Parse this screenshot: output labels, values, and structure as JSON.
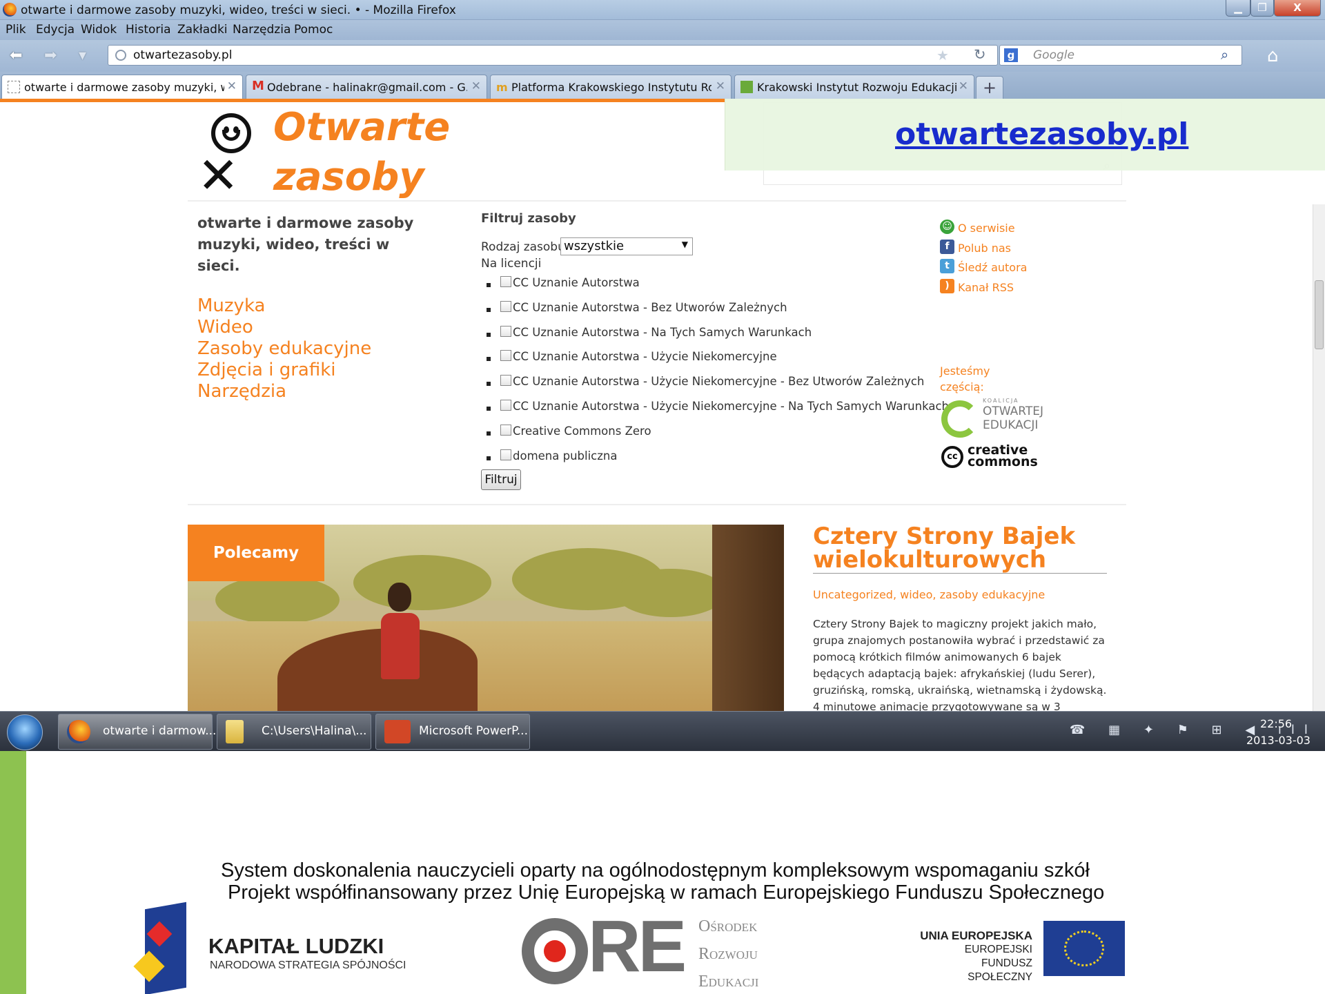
{
  "window": {
    "title": "otwarte i darmowe zasoby muzyki, wideo, treści w sieci. • - Mozilla Firefox",
    "controls": {
      "minimize": "▁",
      "maximize": "❐",
      "close": "X"
    }
  },
  "menubar": {
    "items": [
      "Plik",
      "Edycja",
      "Widok",
      "Historia",
      "Zakładki",
      "Narzędzia",
      "Pomoc"
    ]
  },
  "navbar": {
    "url": "otwartezasoby.pl",
    "search_placeholder": "Google"
  },
  "tabs": [
    {
      "label": "otwarte i darmowe zasoby muzyki, wi..."
    },
    {
      "label": "Odebrane - halinakr@gmail.com - G..."
    },
    {
      "label": "Platforma Krakowskiego Instytutu Ro..."
    },
    {
      "label": "Krakowski Instytut Rozwoju Edukacji ..."
    }
  ],
  "site": {
    "logo_line1": "Otwarte",
    "logo_line2": "zasoby",
    "overlay_link": "otwartezasoby.pl",
    "tagline": "otwarte i darmowe zasoby muzyki, wideo, treści w sieci.",
    "categories": [
      "Muzyka",
      "Wideo",
      "Zasoby edukacyjne",
      "Zdjęcia i grafiki",
      "Narzędzia"
    ],
    "filter": {
      "title": "Filtruj zasoby",
      "type_label": "Rodzaj zasobu",
      "type_value": "wszystkie",
      "license_label": "Na licencji",
      "licenses": [
        "CC Uznanie Autorstwa",
        "CC Uznanie Autorstwa - Bez Utworów Zależnych",
        "CC Uznanie Autorstwa - Na Tych Samych Warunkach",
        "CC Uznanie Autorstwa - Użycie Niekomercyjne",
        "CC Uznanie Autorstwa - Użycie Niekomercyjne - Bez Utworów Zależnych",
        "CC Uznanie Autorstwa - Użycie Niekomercyjne - Na Tych Samych Warunkach",
        "Creative Commons Zero",
        "domena publiczna"
      ],
      "submit": "Filtruj"
    },
    "side_links": [
      {
        "label": "O serwisie",
        "icon": "smiley-icon",
        "color": "#3aa33a"
      },
      {
        "label": "Polub nas",
        "icon": "facebook-icon",
        "color": "#3b5998"
      },
      {
        "label": "Śledź autora",
        "icon": "twitter-icon",
        "color": "#4a9fd8"
      },
      {
        "label": "Kanał RSS",
        "icon": "rss-icon",
        "color": "#f58220"
      }
    ],
    "partners_label": "Jesteśmy częścią:",
    "koalicja": {
      "small": "KOALICJA",
      "name": "OTWARTEJ EDUKACJI"
    },
    "cc_logo": {
      "mark": "cc",
      "name": "creative commons"
    },
    "featured_badge": "Polecamy",
    "article": {
      "title": "Cztery Strony Bajek wielokulturowych",
      "categories": "Uncategorized, wideo, zasoby edukacyjne",
      "body": "Cztery Strony Bajek to magiczny projekt jakich mało, grupa znajomych postanowiła wybrać i przedstawić za pomocą krótkich filmów animowanych 6 bajek będących adaptacją bajek: afrykańskiej (ludu Serer), gruzińską, romską, ukraińską, wietnamską i żydowską. 4 minutowe animacje przygotowywane są w 3"
    },
    "accent_color": "#f58220"
  },
  "taskbar": {
    "buttons": [
      {
        "label": "otwarte i darmow...",
        "icon": "firefox-icon"
      },
      {
        "label": "C:\\Users\\Halina\\...",
        "icon": "folder-icon"
      },
      {
        "label": "Microsoft PowerP...",
        "icon": "powerpoint-icon"
      }
    ],
    "tray_icons": "☎ ▦ ✦ ⚑ ⊞ ◀ ıll",
    "time": "22:56",
    "date": "2013-03-03"
  },
  "footer": {
    "line1": "System doskonalenia nauczycieli oparty na ogólnodostępnym kompleksowym wspomaganiu szkół",
    "line2": "Projekt współfinansowany przez Unię Europejską w ramach Europejskiego Funduszu Społecznego",
    "kapital_title": "KAPITAŁ LUDZKI",
    "kapital_sub": "NARODOWA STRATEGIA SPÓJNOŚCI",
    "ore_letters": "RE",
    "ore_lines": [
      "Ośrodek",
      "Rozwoju",
      "Edukacji"
    ],
    "ue_line1": "UNIA EUROPEJSKA",
    "ue_line2": "EUROPEJSKI",
    "ue_line3": "FUNDUSZ SPOŁECZNY"
  }
}
